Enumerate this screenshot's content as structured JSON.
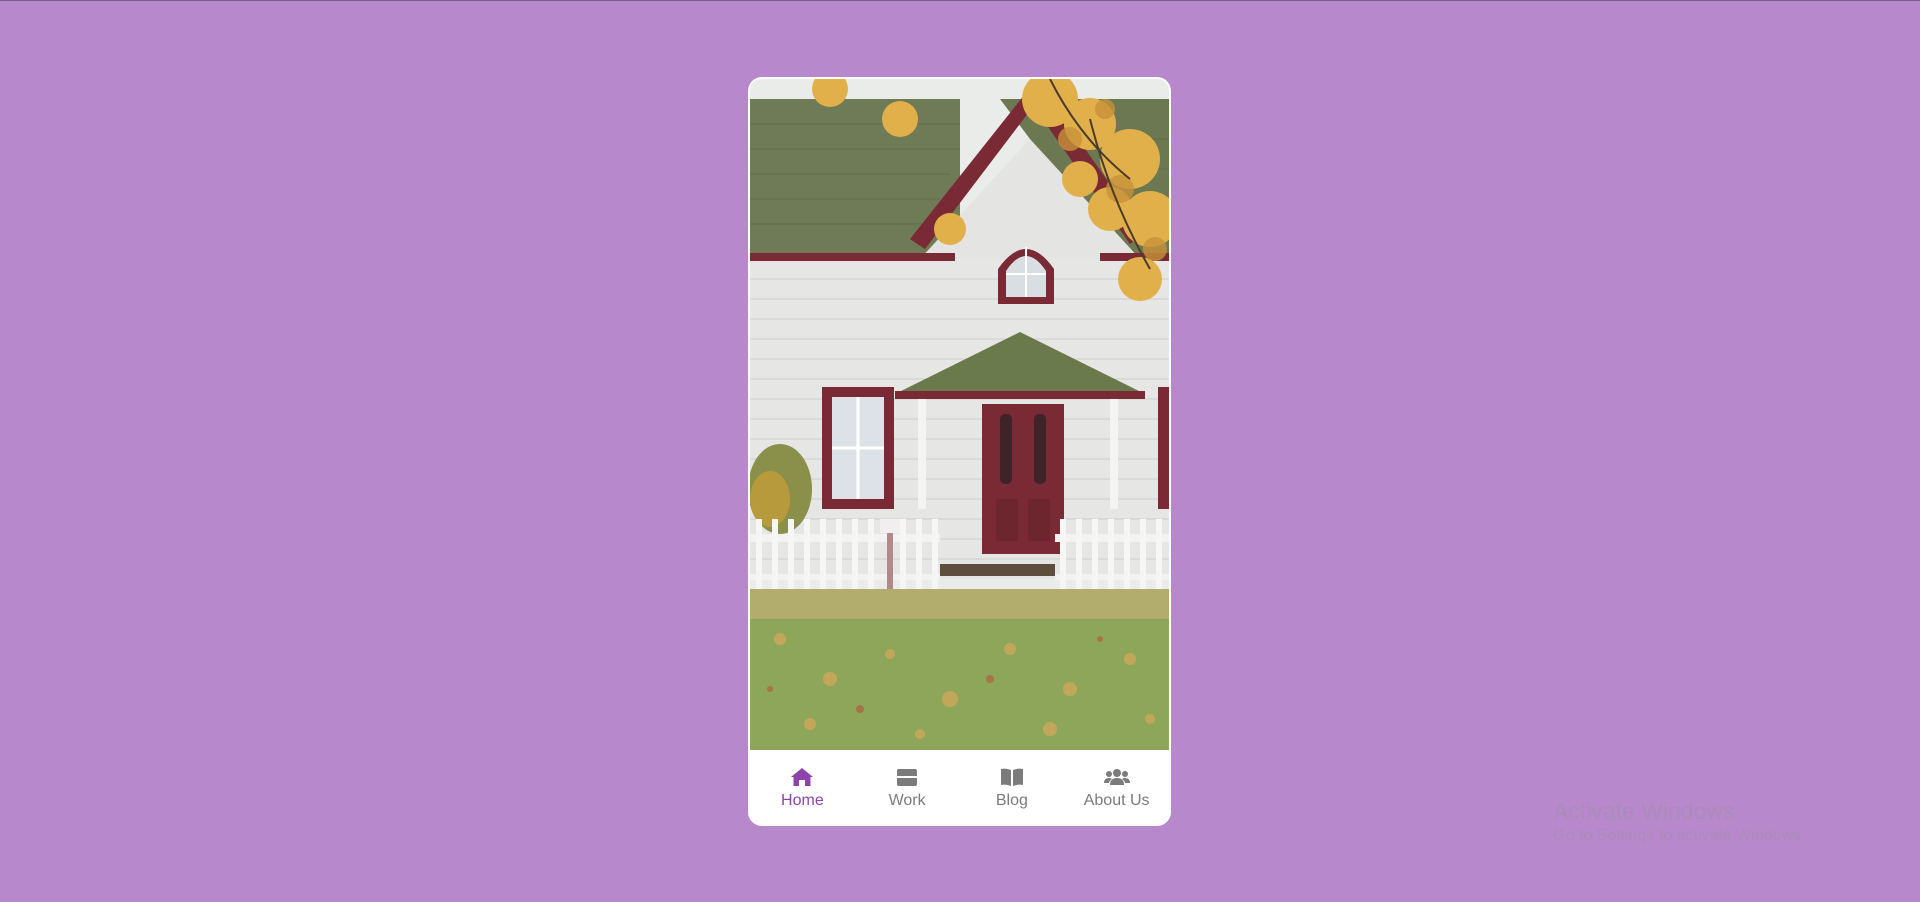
{
  "hero": {
    "image_subject": "house-photo"
  },
  "bottom_nav": {
    "active_color": "#8e44ad",
    "inactive_color": "#7b7b7b",
    "items": [
      {
        "label": "Home",
        "icon": "home-icon",
        "active": true
      },
      {
        "label": "Work",
        "icon": "briefcase-icon",
        "active": false
      },
      {
        "label": "Blog",
        "icon": "book-icon",
        "active": false
      },
      {
        "label": "About Us",
        "icon": "users-icon",
        "active": false
      }
    ]
  },
  "colors": {
    "page_background": "#b788cb",
    "card_background": "#ffffff"
  },
  "watermark": {
    "title": "Activate Windows",
    "subtitle": "Go to Settings to activate Windows."
  }
}
